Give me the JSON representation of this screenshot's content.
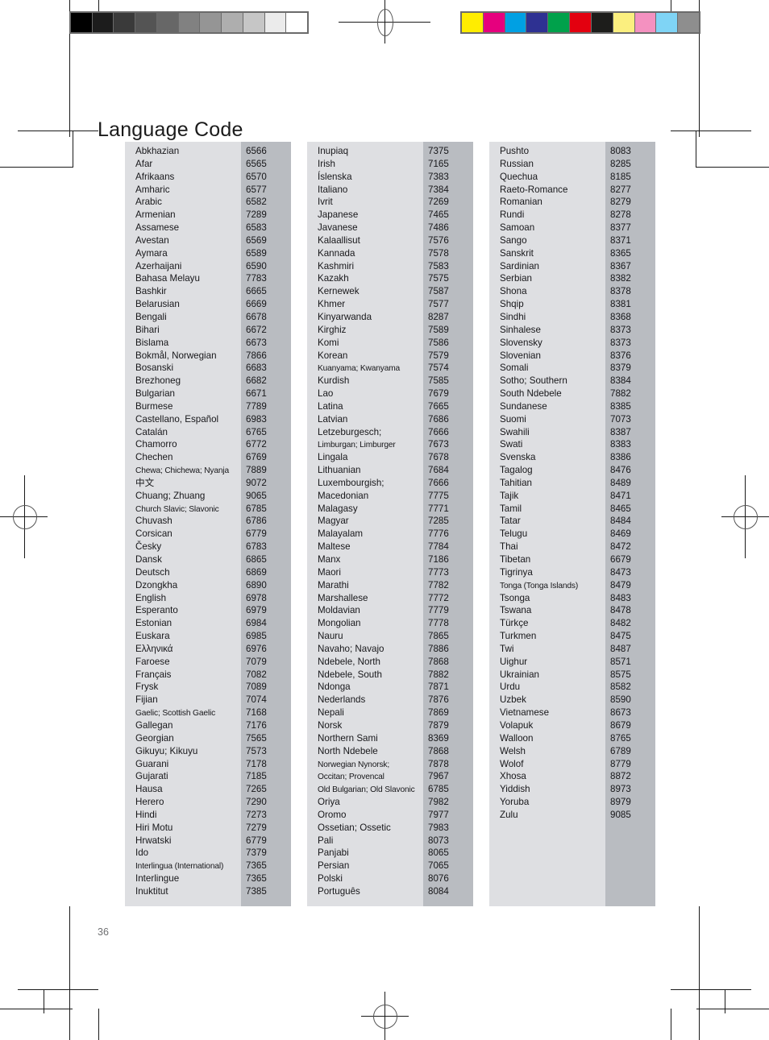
{
  "page": {
    "title": "Language Code",
    "folio": "36"
  },
  "calibration": {
    "grayscale_bar": {
      "name": "grayscale-calibration-bar",
      "swatches": [
        "#000000",
        "#1c1c1c",
        "#3a3a3a",
        "#545454",
        "#676767",
        "#818181",
        "#959595",
        "#aeaeae",
        "#c6c6c6",
        "#ebebeb",
        "#ffffff"
      ]
    },
    "color_bar": {
      "name": "color-calibration-bar",
      "swatches": [
        "#ffed00",
        "#e6007e",
        "#00a0e3",
        "#2e3192",
        "#00a14b",
        "#e3000f",
        "#1d1d1b",
        "#fbef7f",
        "#f491c0",
        "#7fd4f5",
        "#8e8e8e"
      ]
    }
  },
  "tables": [
    {
      "name": "language-table-column-1",
      "rows": [
        {
          "name": "Abkhazian",
          "code": "6566"
        },
        {
          "name": "Afar",
          "code": "6565"
        },
        {
          "name": "Afrikaans",
          "code": "6570"
        },
        {
          "name": "Amharic",
          "code": "6577"
        },
        {
          "name": "Arabic",
          "code": "6582"
        },
        {
          "name": "Armenian",
          "code": "7289"
        },
        {
          "name": "Assamese",
          "code": "6583"
        },
        {
          "name": "Avestan",
          "code": "6569"
        },
        {
          "name": "Aymara",
          "code": "6589"
        },
        {
          "name": "Azerhaijani",
          "code": "6590"
        },
        {
          "name": "Bahasa Melayu",
          "code": "7783"
        },
        {
          "name": "Bashkir",
          "code": "6665"
        },
        {
          "name": "Belarusian",
          "code": "6669"
        },
        {
          "name": "Bengali",
          "code": "6678"
        },
        {
          "name": "Bihari",
          "code": "6672"
        },
        {
          "name": "Bislama",
          "code": "6673"
        },
        {
          "name": "Bokmål, Norwegian",
          "code": "7866"
        },
        {
          "name": "Bosanski",
          "code": "6683"
        },
        {
          "name": "Brezhoneg",
          "code": "6682"
        },
        {
          "name": "Bulgarian",
          "code": "6671"
        },
        {
          "name": "Burmese",
          "code": "7789"
        },
        {
          "name": "Castellano, Español",
          "code": "6983"
        },
        {
          "name": "Catalán",
          "code": "6765"
        },
        {
          "name": "Chamorro",
          "code": "6772"
        },
        {
          "name": "Chechen",
          "code": "6769"
        },
        {
          "name": "Chewa; Chichewa; Nyanja",
          "code": "7889",
          "squeeze": true
        },
        {
          "name": "中文",
          "code": "9072"
        },
        {
          "name": "Chuang; Zhuang",
          "code": "9065"
        },
        {
          "name": "Church Slavic; Slavonic",
          "code": "6785",
          "squeeze": true
        },
        {
          "name": "Chuvash",
          "code": "6786"
        },
        {
          "name": "Corsican",
          "code": "6779"
        },
        {
          "name": "Česky",
          "code": "6783"
        },
        {
          "name": "Dansk",
          "code": "6865"
        },
        {
          "name": "Deutsch",
          "code": "6869"
        },
        {
          "name": "Dzongkha",
          "code": "6890"
        },
        {
          "name": "English",
          "code": "6978"
        },
        {
          "name": "Esperanto",
          "code": "6979"
        },
        {
          "name": "Estonian",
          "code": "6984"
        },
        {
          "name": "Euskara",
          "code": "6985"
        },
        {
          "name": "Ελληνικά",
          "code": "6976"
        },
        {
          "name": "Faroese",
          "code": "7079"
        },
        {
          "name": "Français",
          "code": "7082"
        },
        {
          "name": "Frysk",
          "code": "7089"
        },
        {
          "name": "Fijian",
          "code": "7074"
        },
        {
          "name": "Gaelic; Scottish Gaelic",
          "code": "7168",
          "squeeze": true
        },
        {
          "name": "Gallegan",
          "code": "7176"
        },
        {
          "name": "Georgian",
          "code": "7565"
        },
        {
          "name": "Gikuyu; Kikuyu",
          "code": "7573"
        },
        {
          "name": "Guarani",
          "code": "7178"
        },
        {
          "name": "Gujarati",
          "code": "7185"
        },
        {
          "name": "Hausa",
          "code": "7265"
        },
        {
          "name": "Herero",
          "code": "7290"
        },
        {
          "name": "Hindi",
          "code": "7273"
        },
        {
          "name": "Hiri Motu",
          "code": "7279"
        },
        {
          "name": "Hrwatski",
          "code": "6779"
        },
        {
          "name": "Ido",
          "code": "7379"
        },
        {
          "name": "Interlingua (International)",
          "code": "7365",
          "squeeze": true
        },
        {
          "name": "Interlingue",
          "code": "7365"
        },
        {
          "name": "Inuktitut",
          "code": "7385"
        }
      ]
    },
    {
      "name": "language-table-column-2",
      "rows": [
        {
          "name": "Inupiaq",
          "code": "7375"
        },
        {
          "name": "Irish",
          "code": "7165"
        },
        {
          "name": "Íslenska",
          "code": "7383"
        },
        {
          "name": "Italiano",
          "code": "7384"
        },
        {
          "name": "Ivrit",
          "code": "7269"
        },
        {
          "name": "Japanese",
          "code": "7465"
        },
        {
          "name": "Javanese",
          "code": "7486"
        },
        {
          "name": "Kalaallisut",
          "code": "7576"
        },
        {
          "name": "Kannada",
          "code": "7578"
        },
        {
          "name": "Kashmiri",
          "code": "7583"
        },
        {
          "name": "Kazakh",
          "code": "7575"
        },
        {
          "name": "Kernewek",
          "code": "7587"
        },
        {
          "name": "Khmer",
          "code": "7577"
        },
        {
          "name": "Kinyarwanda",
          "code": "8287"
        },
        {
          "name": "Kirghiz",
          "code": "7589"
        },
        {
          "name": "Komi",
          "code": "7586"
        },
        {
          "name": "Korean",
          "code": "7579"
        },
        {
          "name": "Kuanyama; Kwanyama",
          "code": "7574",
          "squeeze": true
        },
        {
          "name": "Kurdish",
          "code": "7585"
        },
        {
          "name": "Lao",
          "code": "7679"
        },
        {
          "name": "Latina",
          "code": "7665"
        },
        {
          "name": "Latvian",
          "code": "7686"
        },
        {
          "name": "Letzeburgesch;",
          "code": "7666"
        },
        {
          "name": "Limburgan; Limburger",
          "code": "7673",
          "squeeze": true
        },
        {
          "name": "Lingala",
          "code": "7678"
        },
        {
          "name": "Lithuanian",
          "code": "7684"
        },
        {
          "name": "Luxembourgish;",
          "code": "7666"
        },
        {
          "name": "Macedonian",
          "code": "7775"
        },
        {
          "name": "Malagasy",
          "code": "7771"
        },
        {
          "name": "Magyar",
          "code": "7285"
        },
        {
          "name": "Malayalam",
          "code": "7776"
        },
        {
          "name": "Maltese",
          "code": "7784"
        },
        {
          "name": "Manx",
          "code": "7186"
        },
        {
          "name": "Maori",
          "code": "7773"
        },
        {
          "name": "Marathi",
          "code": "7782"
        },
        {
          "name": "Marshallese",
          "code": "7772"
        },
        {
          "name": "Moldavian",
          "code": "7779"
        },
        {
          "name": "Mongolian",
          "code": "7778"
        },
        {
          "name": "Nauru",
          "code": "7865"
        },
        {
          "name": "Navaho; Navajo",
          "code": "7886"
        },
        {
          "name": "Ndebele, North",
          "code": "7868"
        },
        {
          "name": "Ndebele, South",
          "code": "7882"
        },
        {
          "name": "Ndonga",
          "code": "7871"
        },
        {
          "name": "Nederlands",
          "code": "7876"
        },
        {
          "name": "Nepali",
          "code": "7869"
        },
        {
          "name": "Norsk",
          "code": "7879"
        },
        {
          "name": "Northern Sami",
          "code": "8369"
        },
        {
          "name": "North Ndebele",
          "code": "7868"
        },
        {
          "name": "Norwegian Nynorsk;",
          "code": "7878",
          "squeeze": true
        },
        {
          "name": "Occitan; Provencal",
          "code": "7967",
          "squeeze": true
        },
        {
          "name": "Old Bulgarian; Old Slavonic",
          "code": "6785",
          "squeeze": true
        },
        {
          "name": "Oriya",
          "code": "7982"
        },
        {
          "name": "Oromo",
          "code": "7977"
        },
        {
          "name": "Ossetian; Ossetic",
          "code": "7983"
        },
        {
          "name": "Pali",
          "code": "8073"
        },
        {
          "name": "Panjabi",
          "code": "8065"
        },
        {
          "name": "Persian",
          "code": "7065"
        },
        {
          "name": "Polski",
          "code": "8076"
        },
        {
          "name": "Português",
          "code": "8084"
        }
      ]
    },
    {
      "name": "language-table-column-3",
      "rows": [
        {
          "name": "Pushto",
          "code": "8083"
        },
        {
          "name": "Russian",
          "code": "8285"
        },
        {
          "name": "Quechua",
          "code": "8185"
        },
        {
          "name": "Raeto-Romance",
          "code": "8277"
        },
        {
          "name": "Romanian",
          "code": "8279"
        },
        {
          "name": "Rundi",
          "code": "8278"
        },
        {
          "name": "Samoan",
          "code": "8377"
        },
        {
          "name": "Sango",
          "code": "8371"
        },
        {
          "name": "Sanskrit",
          "code": "8365"
        },
        {
          "name": "Sardinian",
          "code": "8367"
        },
        {
          "name": "Serbian",
          "code": "8382"
        },
        {
          "name": "Shona",
          "code": "8378"
        },
        {
          "name": "Shqip",
          "code": "8381"
        },
        {
          "name": "Sindhi",
          "code": "8368"
        },
        {
          "name": "Sinhalese",
          "code": "8373"
        },
        {
          "name": "Slovensky",
          "code": "8373"
        },
        {
          "name": "Slovenian",
          "code": "8376"
        },
        {
          "name": "Somali",
          "code": "8379"
        },
        {
          "name": "Sotho; Southern",
          "code": "8384"
        },
        {
          "name": "South Ndebele",
          "code": "7882"
        },
        {
          "name": "Sundanese",
          "code": "8385"
        },
        {
          "name": "Suomi",
          "code": "7073"
        },
        {
          "name": "Swahili",
          "code": "8387"
        },
        {
          "name": "Swati",
          "code": "8383"
        },
        {
          "name": "Svenska",
          "code": "8386"
        },
        {
          "name": "Tagalog",
          "code": "8476"
        },
        {
          "name": "Tahitian",
          "code": "8489"
        },
        {
          "name": "Tajik",
          "code": "8471"
        },
        {
          "name": "Tamil",
          "code": "8465"
        },
        {
          "name": "Tatar",
          "code": "8484"
        },
        {
          "name": "Telugu",
          "code": "8469"
        },
        {
          "name": "Thai",
          "code": "8472"
        },
        {
          "name": "Tibetan",
          "code": "6679"
        },
        {
          "name": "Tigrinya",
          "code": "8473"
        },
        {
          "name": "Tonga (Tonga Islands)",
          "code": "8479",
          "squeeze": true
        },
        {
          "name": "Tsonga",
          "code": "8483"
        },
        {
          "name": "Tswana",
          "code": "8478"
        },
        {
          "name": "Türkçe",
          "code": "8482"
        },
        {
          "name": "Turkmen",
          "code": "8475"
        },
        {
          "name": "Twi",
          "code": "8487"
        },
        {
          "name": "Uighur",
          "code": "8571"
        },
        {
          "name": "Ukrainian",
          "code": "8575"
        },
        {
          "name": "Urdu",
          "code": "8582"
        },
        {
          "name": "Uzbek",
          "code": "8590"
        },
        {
          "name": "Vietnamese",
          "code": "8673"
        },
        {
          "name": "Volapuk",
          "code": "8679"
        },
        {
          "name": "Walloon",
          "code": "8765"
        },
        {
          "name": "Welsh",
          "code": "6789"
        },
        {
          "name": "Wolof",
          "code": "8779"
        },
        {
          "name": "Xhosa",
          "code": "8872"
        },
        {
          "name": "Yiddish",
          "code": "8973"
        },
        {
          "name": "Yoruba",
          "code": "8979"
        },
        {
          "name": "Zulu",
          "code": "9085"
        }
      ]
    }
  ]
}
